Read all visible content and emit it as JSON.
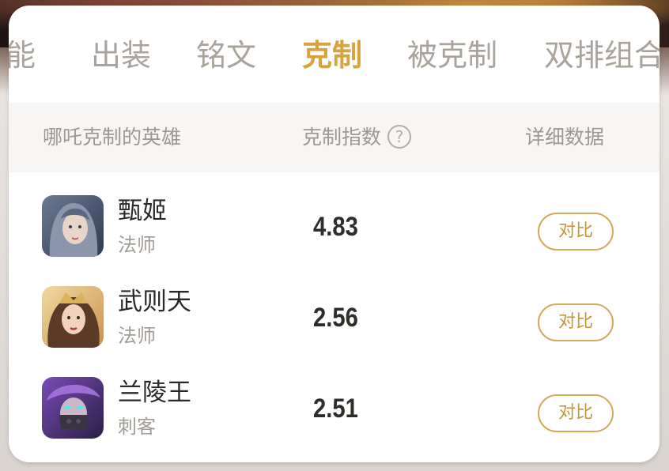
{
  "tabs": [
    "能",
    "出装",
    "铭文",
    "克制",
    "被克制",
    "双排组合"
  ],
  "active_tab": "克制",
  "header": {
    "col_hero": "哪吒克制的英雄",
    "col_index": "克制指数",
    "col_index_help": "?",
    "col_detail": "详细数据"
  },
  "rows": [
    {
      "name": "甄姬",
      "role": "法师",
      "score": "4.83",
      "action": "对比",
      "avatar_icon": "hero-avatar-zhenji"
    },
    {
      "name": "武则天",
      "role": "法师",
      "score": "2.56",
      "action": "对比",
      "avatar_icon": "hero-avatar-wuzetian"
    },
    {
      "name": "兰陵王",
      "role": "刺客",
      "score": "2.51",
      "action": "对比",
      "avatar_icon": "hero-avatar-lanlingwang"
    }
  ],
  "colors": {
    "accent": "#d6a33f",
    "tab_inactive": "#a9a39c",
    "button_border": "#d2aa5c"
  }
}
